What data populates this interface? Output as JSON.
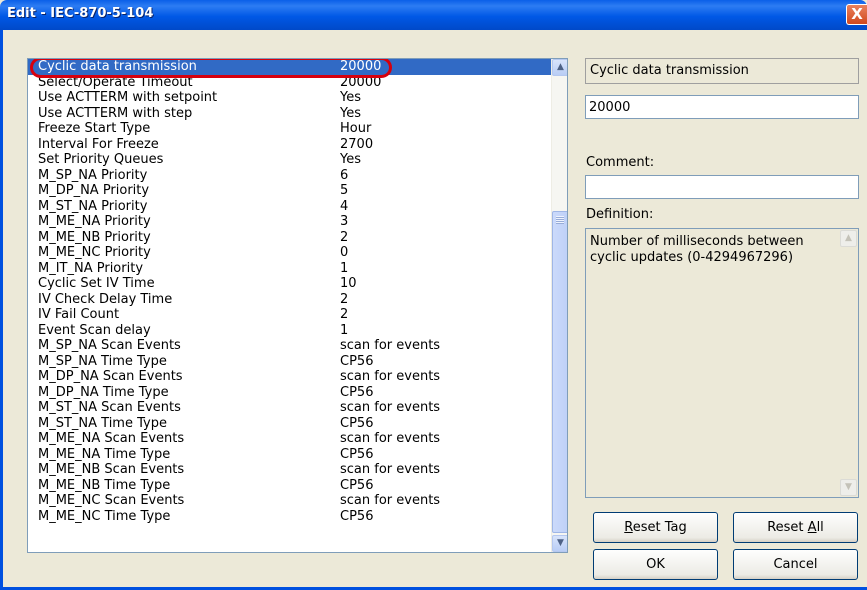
{
  "window": {
    "title": "Edit - IEC-870-5-104",
    "close_glyph": "X"
  },
  "list": {
    "rows": [
      {
        "name": "Cyclic data transmission",
        "value": "20000"
      },
      {
        "name": "Select/Operate Timeout",
        "value": "20000"
      },
      {
        "name": "Use ACTTERM with setpoint",
        "value": "Yes"
      },
      {
        "name": "Use ACTTERM with step",
        "value": "Yes"
      },
      {
        "name": "Freeze Start Type",
        "value": "Hour"
      },
      {
        "name": "Interval For Freeze",
        "value": "2700"
      },
      {
        "name": "Set Priority Queues",
        "value": "Yes"
      },
      {
        "name": "M_SP_NA Priority",
        "value": "6"
      },
      {
        "name": "M_DP_NA Priority",
        "value": "5"
      },
      {
        "name": "M_ST_NA Priority",
        "value": "4"
      },
      {
        "name": "M_ME_NA Priority",
        "value": "3"
      },
      {
        "name": "M_ME_NB Priority",
        "value": "2"
      },
      {
        "name": "M_ME_NC Priority",
        "value": "0"
      },
      {
        "name": "M_IT_NA Priority",
        "value": "1"
      },
      {
        "name": "Cyclic Set IV Time",
        "value": "10"
      },
      {
        "name": "IV Check Delay Time",
        "value": "2"
      },
      {
        "name": "IV Fail Count",
        "value": "2"
      },
      {
        "name": "Event Scan delay",
        "value": "1"
      },
      {
        "name": "M_SP_NA Scan Events",
        "value": "scan for events"
      },
      {
        "name": "M_SP_NA Time Type",
        "value": "CP56"
      },
      {
        "name": "M_DP_NA Scan Events",
        "value": "scan for events"
      },
      {
        "name": "M_DP_NA Time Type",
        "value": "CP56"
      },
      {
        "name": "M_ST_NA Scan Events",
        "value": "scan for events"
      },
      {
        "name": "M_ST_NA Time Type",
        "value": "CP56"
      },
      {
        "name": "M_ME_NA Scan Events",
        "value": "scan for events"
      },
      {
        "name": "M_ME_NA Time Type",
        "value": "CP56"
      },
      {
        "name": "M_ME_NB Scan Events",
        "value": "scan for events"
      },
      {
        "name": "M_ME_NB Time Type",
        "value": "CP56"
      },
      {
        "name": "M_ME_NC Scan Events",
        "value": "scan for events"
      },
      {
        "name": "M_ME_NC Time Type",
        "value": "CP56"
      }
    ],
    "selected_index": 0
  },
  "editor": {
    "field_name": "Cyclic data transmission",
    "value": "20000",
    "comment_label": "Comment:",
    "comment_value": "",
    "definition_label": "Definition:",
    "definition_text": "Number of milliseconds between cyclic updates (0-4294967296)"
  },
  "buttons": {
    "reset_tag": {
      "accel": "R",
      "rest": "eset Tag"
    },
    "reset_all": {
      "pre": "Reset ",
      "accel": "A",
      "rest": "ll"
    },
    "ok": "OK",
    "cancel": "Cancel"
  },
  "icons": {
    "scroll_up": "▲",
    "scroll_down": "▼",
    "def_scroll_up": "▲",
    "def_scroll_down": "▼"
  },
  "colors": {
    "selection": "#316ac5",
    "highlight_ring": "#d6000e",
    "title_bar": "#0058e6"
  }
}
